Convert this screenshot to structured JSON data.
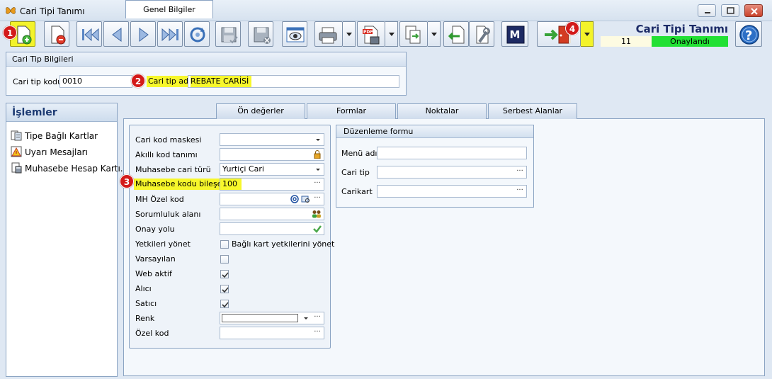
{
  "window": {
    "title": "Cari Tipi Tanımı"
  },
  "header": {
    "form_title": "Cari Tipi Tanımı",
    "record_no": "11",
    "status": "Onaylandı",
    "status_color": "#22e034",
    "highlight_color": "#f3f32a"
  },
  "annotations": {
    "b1": "1",
    "b2": "2",
    "b3": "3",
    "b4": "4"
  },
  "toolbar": {
    "icons": [
      "new-document-icon",
      "delete-document-icon",
      "first-record-icon",
      "previous-record-icon",
      "next-record-icon",
      "last-record-icon",
      "refresh-icon",
      "save-icon",
      "cancel-save-icon",
      "preview-icon",
      "print-icon",
      "pdf-export-icon",
      "copy-icon",
      "import-icon",
      "settings-tools-icon",
      "m-icon",
      "exit-door-icon",
      "help-icon"
    ],
    "m_label": "M"
  },
  "cari_tip_bilgileri": {
    "heading": "Cari Tip Bilgileri",
    "kod_label": "Cari tip kodu",
    "kod_value": "0010",
    "adi_label": "Cari tip adı",
    "adi_value": "REBATE CARİSİ"
  },
  "islemler": {
    "heading": "İşlemler",
    "items": [
      {
        "label": "Tipe Bağlı Kartlar",
        "icon": "linked-cards-icon"
      },
      {
        "label": "Uyarı Mesajları",
        "icon": "warning-messages-icon"
      },
      {
        "label": "Muhasebe Hesap Kartı...",
        "icon": "accounting-card-icon"
      }
    ]
  },
  "tabs": [
    {
      "label": "Genel Bilgiler",
      "active": true
    },
    {
      "label": "Ön değerler",
      "active": false
    },
    {
      "label": "Formlar",
      "active": false
    },
    {
      "label": "Noktalar",
      "active": false
    },
    {
      "label": "Serbest Alanlar",
      "active": false
    }
  ],
  "genel": {
    "cari_kod_maskesi": {
      "label": "Cari kod maskesi",
      "value": ""
    },
    "akilli_kod": {
      "label": "Akıllı kod tanımı",
      "value": ""
    },
    "muhasebe_cari_turu": {
      "label": "Muhasebe cari türü",
      "value": "Yurtiçi Cari"
    },
    "muhasebe_kodu_bileseni": {
      "label": "Muhasebe kodu bileşeni",
      "value": "100"
    },
    "mh_ozel_kod": {
      "label": "MH Özel kod",
      "value": ""
    },
    "sorumluluk": {
      "label": "Sorumluluk alanı",
      "value": ""
    },
    "onay_yolu": {
      "label": "Onay yolu",
      "value": ""
    },
    "yetkileri_yonet": {
      "label": "Yetkileri yönet",
      "checkbox_label": "Bağlı kart yetkilerini yönet",
      "checked": false
    },
    "varsayilan": {
      "label": "Varsayılan",
      "checked": false
    },
    "web_aktif": {
      "label": "Web aktif",
      "checked": true
    },
    "alici": {
      "label": "Alıcı",
      "checked": true
    },
    "satici": {
      "label": "Satıcı",
      "checked": true
    },
    "renk": {
      "label": "Renk",
      "value": ""
    },
    "ozel_kod": {
      "label": "Özel kod",
      "value": ""
    }
  },
  "duzenleme_formu": {
    "heading": "Düzenleme formu",
    "menu_adi": {
      "label": "Menü adı",
      "value": ""
    },
    "cari_tip": {
      "label": "Cari tip",
      "value": ""
    },
    "carikart": {
      "label": "Carikart",
      "value": ""
    }
  },
  "glyphs": {
    "ellipsis": "···"
  }
}
